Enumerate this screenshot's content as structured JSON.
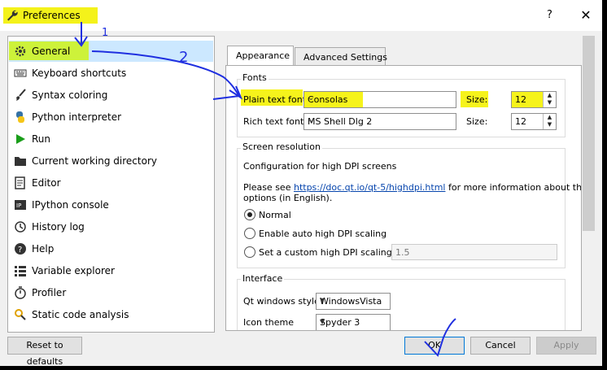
{
  "window": {
    "title": "Preferences",
    "help": "?",
    "close": "✕"
  },
  "sidebar": {
    "items": [
      {
        "label": "General",
        "icon": "gear-icon"
      },
      {
        "label": "Keyboard shortcuts",
        "icon": "keyboard-icon"
      },
      {
        "label": "Syntax coloring",
        "icon": "paint-brush-icon"
      },
      {
        "label": "Python interpreter",
        "icon": "python-icon"
      },
      {
        "label": "Run",
        "icon": "play-icon"
      },
      {
        "label": "Current working directory",
        "icon": "folder-icon"
      },
      {
        "label": "Editor",
        "icon": "editor-icon"
      },
      {
        "label": "IPython console",
        "icon": "ipython-icon"
      },
      {
        "label": "History log",
        "icon": "history-icon"
      },
      {
        "label": "Help",
        "icon": "help-icon"
      },
      {
        "label": "Variable explorer",
        "icon": "variable-explorer-icon"
      },
      {
        "label": "Profiler",
        "icon": "profiler-icon"
      },
      {
        "label": "Static code analysis",
        "icon": "code-analysis-icon"
      }
    ]
  },
  "tabs": [
    {
      "label": "Appearance"
    },
    {
      "label": "Advanced Settings"
    }
  ],
  "fonts": {
    "group_title": "Fonts",
    "plain_label": "Plain text font",
    "plain_value": "Consolas",
    "size_label": "Size:",
    "plain_size": "12",
    "rich_label": "Rich text font",
    "rich_value": "MS Shell Dlg 2",
    "rich_size": "12"
  },
  "screen": {
    "group_title": "Screen resolution",
    "config_text": "Configuration for high DPI screens",
    "see_prefix": "Please see ",
    "link": "https://doc.qt.io/qt-5/highdpi.html",
    "see_suffix": " for more information about these",
    "see_line2": "options (in English).",
    "normal": "Normal",
    "auto": "Enable auto high DPI scaling",
    "custom": "Set a custom high DPI scaling",
    "custom_value": "1.5"
  },
  "interface": {
    "group_title": "Interface",
    "style_label": "Qt windows style",
    "style_value": "WindowsVista",
    "theme_label": "Icon theme",
    "theme_value": "Spyder 3"
  },
  "footer": {
    "reset": "Reset to defaults",
    "ok": "OK",
    "cancel": "Cancel",
    "apply": "Apply"
  },
  "annotations": {
    "one": "1",
    "two": "2"
  }
}
